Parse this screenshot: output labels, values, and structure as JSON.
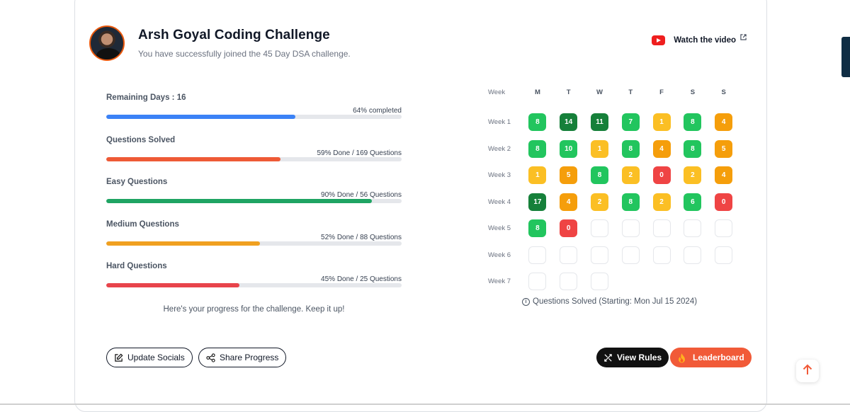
{
  "header": {
    "title": "Arsh Goyal Coding Challenge",
    "subtitle": "You have successfully joined the 45 Day DSA challenge.",
    "watch_label": "Watch the video",
    "avatar_icon": "profile-photo"
  },
  "progress": [
    {
      "label": "Remaining Days : 16",
      "right": "64% completed",
      "percent": 64,
      "color": "#3b82f6"
    },
    {
      "label": "Questions Solved",
      "right": "59% Done / 169 Questions",
      "percent": 59,
      "color": "#ee5a36"
    },
    {
      "label": "Easy Questions",
      "right": "90% Done / 56 Questions",
      "percent": 90,
      "color": "#1fa463"
    },
    {
      "label": "Medium Questions",
      "right": "52% Done / 88 Questions",
      "percent": 52,
      "color": "#f0a020"
    },
    {
      "label": "Hard Questions",
      "right": "45% Done / 25 Questions",
      "percent": 45,
      "color": "#e8444b"
    }
  ],
  "progress_note": "Here's your progress for the challenge. Keep it up!",
  "calendar": {
    "week_header": "Week",
    "days": [
      "M",
      "T",
      "W",
      "T",
      "F",
      "S",
      "S"
    ],
    "colors": {
      "dark": "#16803a",
      "green": "#22c55e",
      "yellow": "#fbbf24",
      "orange": "#f59e0b",
      "red": "#ef4444"
    },
    "weeks": [
      {
        "label": "Week 1",
        "cells": [
          {
            "v": "8",
            "c": "green"
          },
          {
            "v": "14",
            "c": "dark"
          },
          {
            "v": "11",
            "c": "dark"
          },
          {
            "v": "7",
            "c": "green"
          },
          {
            "v": "1",
            "c": "yellow"
          },
          {
            "v": "8",
            "c": "green"
          },
          {
            "v": "4",
            "c": "orange"
          }
        ]
      },
      {
        "label": "Week 2",
        "cells": [
          {
            "v": "8",
            "c": "green"
          },
          {
            "v": "10",
            "c": "green"
          },
          {
            "v": "1",
            "c": "yellow"
          },
          {
            "v": "8",
            "c": "green"
          },
          {
            "v": "4",
            "c": "orange"
          },
          {
            "v": "8",
            "c": "green"
          },
          {
            "v": "5",
            "c": "orange"
          }
        ]
      },
      {
        "label": "Week 3",
        "cells": [
          {
            "v": "1",
            "c": "yellow"
          },
          {
            "v": "5",
            "c": "orange"
          },
          {
            "v": "8",
            "c": "green"
          },
          {
            "v": "2",
            "c": "yellow"
          },
          {
            "v": "0",
            "c": "red"
          },
          {
            "v": "2",
            "c": "yellow"
          },
          {
            "v": "4",
            "c": "orange"
          }
        ]
      },
      {
        "label": "Week 4",
        "cells": [
          {
            "v": "17",
            "c": "dark"
          },
          {
            "v": "4",
            "c": "orange"
          },
          {
            "v": "2",
            "c": "yellow"
          },
          {
            "v": "8",
            "c": "green"
          },
          {
            "v": "2",
            "c": "yellow"
          },
          {
            "v": "6",
            "c": "green"
          },
          {
            "v": "0",
            "c": "red"
          }
        ]
      },
      {
        "label": "Week 5",
        "cells": [
          {
            "v": "8",
            "c": "green"
          },
          {
            "v": "0",
            "c": "red"
          },
          {
            "v": "",
            "c": "empty"
          },
          {
            "v": "",
            "c": "empty"
          },
          {
            "v": "",
            "c": "empty"
          },
          {
            "v": "",
            "c": "empty"
          },
          {
            "v": "",
            "c": "empty"
          }
        ]
      },
      {
        "label": "Week 6",
        "cells": [
          {
            "v": "",
            "c": "empty"
          },
          {
            "v": "",
            "c": "empty"
          },
          {
            "v": "",
            "c": "empty"
          },
          {
            "v": "",
            "c": "empty"
          },
          {
            "v": "",
            "c": "empty"
          },
          {
            "v": "",
            "c": "empty"
          },
          {
            "v": "",
            "c": "empty"
          }
        ]
      },
      {
        "label": "Week 7",
        "cells": [
          {
            "v": "",
            "c": "empty"
          },
          {
            "v": "",
            "c": "empty"
          },
          {
            "v": "",
            "c": "empty"
          }
        ]
      }
    ],
    "note": "Questions Solved (Starting: Mon Jul 15 2024)"
  },
  "buttons": {
    "update_socials": "Update Socials",
    "share_progress": "Share Progress",
    "view_rules": "View Rules",
    "leaderboard": "Leaderboard"
  },
  "icons": {
    "youtube": "youtube-icon",
    "external": "external-link-icon",
    "edit": "edit-icon",
    "share": "share-icon",
    "rules": "rules-icon",
    "fire": "fire-icon",
    "scroll_top": "arrow-up-icon"
  }
}
